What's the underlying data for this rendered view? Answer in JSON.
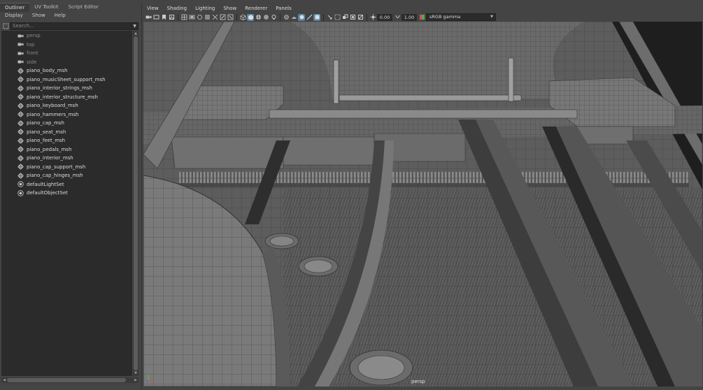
{
  "outliner": {
    "tabs": [
      {
        "label": "Outliner",
        "active": true
      },
      {
        "label": "UV Toolkit",
        "active": false
      },
      {
        "label": "Script Editor",
        "active": false
      }
    ],
    "menu": [
      "Display",
      "Show",
      "Help"
    ],
    "search": {
      "placeholder": "Search..."
    },
    "items": [
      {
        "label": "persp",
        "icon": "camera-icon",
        "dim": true
      },
      {
        "label": "top",
        "icon": "camera-icon",
        "dim": true
      },
      {
        "label": "front",
        "icon": "camera-icon",
        "dim": true
      },
      {
        "label": "side",
        "icon": "camera-icon",
        "dim": true
      },
      {
        "label": "piano_body_msh",
        "icon": "mesh-icon",
        "dim": false
      },
      {
        "label": "piano_musicSheet_support_msh",
        "icon": "mesh-icon",
        "dim": false
      },
      {
        "label": "piano_interior_strings_msh",
        "icon": "mesh-icon",
        "dim": false
      },
      {
        "label": "piano_interior_structure_msh",
        "icon": "mesh-icon",
        "dim": false
      },
      {
        "label": "piano_keyboard_msh",
        "icon": "mesh-icon",
        "dim": false
      },
      {
        "label": "piano_hammers_msh",
        "icon": "mesh-icon",
        "dim": false
      },
      {
        "label": "piano_cap_msh",
        "icon": "mesh-icon",
        "dim": false
      },
      {
        "label": "piano_seat_msh",
        "icon": "mesh-icon",
        "dim": false
      },
      {
        "label": "piano_feet_msh",
        "icon": "mesh-icon",
        "dim": false
      },
      {
        "label": "piano_pedals_msh",
        "icon": "mesh-icon",
        "dim": false
      },
      {
        "label": "piano_interior_msh",
        "icon": "mesh-icon",
        "dim": false
      },
      {
        "label": "piano_cap_support_msh",
        "icon": "mesh-icon",
        "dim": false
      },
      {
        "label": "piano_cap_hinges_msh",
        "icon": "mesh-icon",
        "dim": false
      },
      {
        "label": "defaultLightSet",
        "icon": "set-icon",
        "dim": false
      },
      {
        "label": "defaultObjectSet",
        "icon": "set-icon",
        "dim": false
      }
    ]
  },
  "viewport": {
    "menu": [
      "View",
      "Shading",
      "Lighting",
      "Show",
      "Renderer",
      "Panels"
    ],
    "exposure": "0.00",
    "gamma": "1.00",
    "color_space": "sRGB gamma",
    "camera_label": "persp"
  },
  "colors": {
    "accent": "#5285a6",
    "panel_bg": "#444444",
    "list_bg": "#2b2b2b"
  }
}
